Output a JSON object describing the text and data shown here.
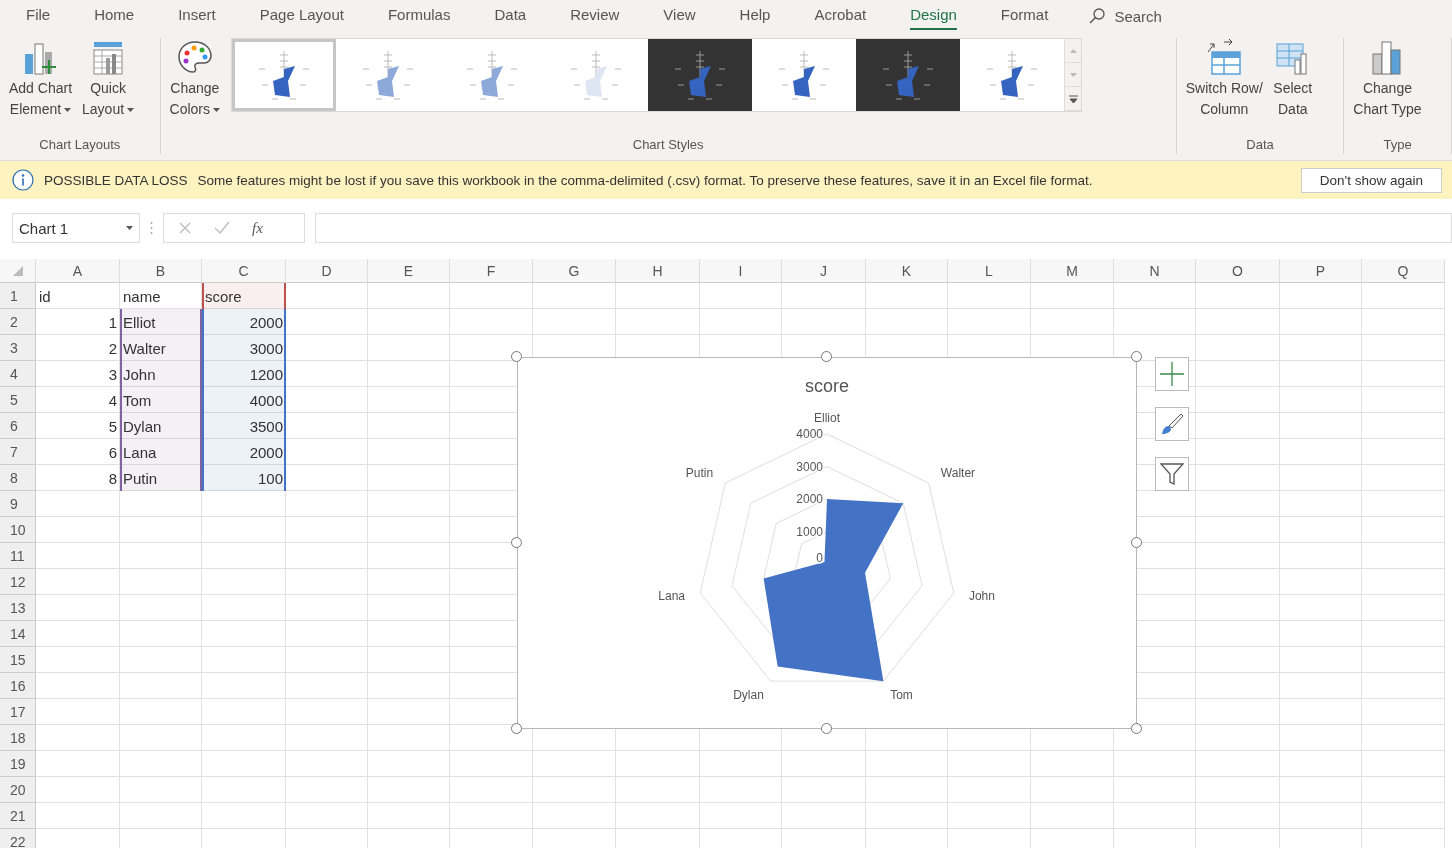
{
  "ribbon_tabs": [
    {
      "label": "File",
      "selected": false
    },
    {
      "label": "Home",
      "selected": false
    },
    {
      "label": "Insert",
      "selected": false
    },
    {
      "label": "Page Layout",
      "selected": false
    },
    {
      "label": "Formulas",
      "selected": false
    },
    {
      "label": "Data",
      "selected": false
    },
    {
      "label": "Review",
      "selected": false
    },
    {
      "label": "View",
      "selected": false
    },
    {
      "label": "Help",
      "selected": false
    },
    {
      "label": "Acrobat",
      "selected": false
    },
    {
      "label": "Design",
      "selected": true
    },
    {
      "label": "Format",
      "selected": false
    }
  ],
  "search": {
    "placeholder": "Search"
  },
  "ribbon_groups": [
    {
      "kind": "buttons",
      "label": "Chart Layouts",
      "buttons": [
        {
          "kind": "add-chart",
          "line1": "Add Chart",
          "line2": "Element",
          "dropdown": true
        },
        {
          "kind": "quick-layout",
          "line1": "Quick",
          "line2": "Layout",
          "dropdown": true
        }
      ]
    },
    {
      "kind": "gallery",
      "label": "Chart Styles",
      "buttons": [
        {
          "kind": "palette",
          "line1": "Change",
          "line2": "Colors",
          "dropdown": true
        }
      ],
      "styles": [
        {
          "dark": false,
          "selected": true
        },
        {
          "dark": false,
          "selected": false
        },
        {
          "dark": false,
          "selected": false
        },
        {
          "dark": false,
          "selected": false
        },
        {
          "dark": true,
          "selected": false
        },
        {
          "dark": false,
          "selected": false
        },
        {
          "dark": true,
          "selected": false
        },
        {
          "dark": false,
          "selected": false
        }
      ]
    },
    {
      "kind": "buttons",
      "label": "Data",
      "buttons": [
        {
          "kind": "switch",
          "line1": "Switch Row/",
          "line2": "Column",
          "dropdown": false
        },
        {
          "kind": "select-data",
          "line1": "Select",
          "line2": "Data",
          "dropdown": false
        }
      ]
    },
    {
      "kind": "buttons",
      "label": "Type",
      "buttons": [
        {
          "kind": "chart-type",
          "line1": "Change",
          "line2": "Chart Type",
          "dropdown": false
        }
      ]
    }
  ],
  "message_bar": {
    "title": "POSSIBLE DATA LOSS",
    "text": "Some features might be lost if you save this workbook in the comma-delimited (.csv) format. To preserve these features, save it in an Excel file format.",
    "button": "Don't show again"
  },
  "formula_bar": {
    "name_box": "Chart 1",
    "function_label": "fx"
  },
  "sheet": {
    "columns": [
      "A",
      "B",
      "C",
      "D",
      "E",
      "F",
      "G",
      "H",
      "I",
      "J",
      "K",
      "L",
      "M",
      "N",
      "O",
      "P",
      "Q"
    ],
    "rows": [
      {
        "number": "1",
        "cells": [
          {
            "text": "id",
            "kind": "text"
          },
          {
            "text": "name",
            "kind": "text"
          },
          {
            "text": "score",
            "kind": "text",
            "color": "#c0504d"
          }
        ]
      },
      {
        "number": "2",
        "cells": [
          {
            "text": "1",
            "kind": "number"
          },
          {
            "text": "Elliot",
            "kind": "text",
            "color": "#8064a2"
          },
          {
            "text": "2000",
            "kind": "number",
            "color": "#4472c4"
          }
        ]
      },
      {
        "number": "3",
        "cells": [
          {
            "text": "2",
            "kind": "number"
          },
          {
            "text": "Walter",
            "kind": "text",
            "color": "#8064a2"
          },
          {
            "text": "3000",
            "kind": "number",
            "color": "#4472c4"
          }
        ]
      },
      {
        "number": "4",
        "cells": [
          {
            "text": "3",
            "kind": "number"
          },
          {
            "text": "John",
            "kind": "text",
            "color": "#8064a2"
          },
          {
            "text": "1200",
            "kind": "number",
            "color": "#4472c4"
          }
        ]
      },
      {
        "number": "5",
        "cells": [
          {
            "text": "4",
            "kind": "number"
          },
          {
            "text": "Tom",
            "kind": "text",
            "color": "#8064a2"
          },
          {
            "text": "4000",
            "kind": "number",
            "color": "#4472c4"
          }
        ]
      },
      {
        "number": "6",
        "cells": [
          {
            "text": "5",
            "kind": "number"
          },
          {
            "text": "Dylan",
            "kind": "text",
            "color": "#8064a2"
          },
          {
            "text": "3500",
            "kind": "number",
            "color": "#4472c4"
          }
        ]
      },
      {
        "number": "7",
        "cells": [
          {
            "text": "6",
            "kind": "number"
          },
          {
            "text": "Lana",
            "kind": "text",
            "color": "#8064a2"
          },
          {
            "text": "2000",
            "kind": "number",
            "color": "#4472c4"
          }
        ]
      },
      {
        "number": "8",
        "cells": [
          {
            "text": "8",
            "kind": "number"
          },
          {
            "text": "Putin",
            "kind": "text",
            "color": "#8064a2"
          },
          {
            "text": "100",
            "kind": "number",
            "color": "#4472c4"
          }
        ]
      },
      {
        "number": "9"
      },
      {
        "number": "10"
      },
      {
        "number": "11"
      },
      {
        "number": "12"
      },
      {
        "number": "13"
      },
      {
        "number": "14"
      },
      {
        "number": "15"
      },
      {
        "number": "16"
      },
      {
        "number": "17"
      },
      {
        "number": "18"
      },
      {
        "number": "19"
      },
      {
        "number": "20"
      },
      {
        "number": "21"
      },
      {
        "number": "22"
      }
    ]
  },
  "chart": {
    "side_buttons": [
      {
        "kind": "add"
      },
      {
        "kind": "style"
      },
      {
        "kind": "filter"
      }
    ],
    "chart_data": {
      "type": "radar",
      "title": "score",
      "categories": [
        "Elliot",
        "Walter",
        "John",
        "Tom",
        "Dylan",
        "Lana",
        "Putin"
      ],
      "series": [
        {
          "color": "#4472c4",
          "values": [
            2000,
            3000,
            1200,
            4000,
            3500,
            2000,
            100
          ]
        }
      ],
      "ylim": [
        0,
        4000
      ],
      "yticks": [
        0,
        1000,
        2000,
        3000,
        4000
      ]
    }
  }
}
